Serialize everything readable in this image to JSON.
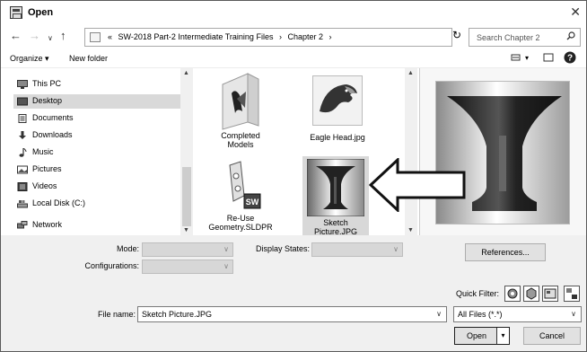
{
  "window": {
    "title": "Open"
  },
  "nav": {
    "breadcrumb": [
      "«",
      "SW-2018 Part-2 Intermediate Training Files",
      "Chapter 2"
    ],
    "search_placeholder": "Search Chapter 2"
  },
  "toolbar": {
    "organize": "Organize ▾",
    "new_folder": "New folder"
  },
  "sidebar": {
    "items": [
      {
        "label": "This PC",
        "icon": "computer-icon"
      },
      {
        "label": "Desktop",
        "icon": "desktop-icon"
      },
      {
        "label": "Documents",
        "icon": "documents-icon"
      },
      {
        "label": "Downloads",
        "icon": "downloads-icon"
      },
      {
        "label": "Music",
        "icon": "music-icon"
      },
      {
        "label": "Pictures",
        "icon": "pictures-icon"
      },
      {
        "label": "Videos",
        "icon": "videos-icon"
      },
      {
        "label": "Local Disk (C:)",
        "icon": "drive-icon"
      },
      {
        "label": "Network",
        "icon": "network-icon"
      }
    ]
  },
  "files": [
    {
      "name1": "Completed",
      "name2": "Models"
    },
    {
      "name1": "Eagle Head.jpg",
      "name2": ""
    },
    {
      "name1": "Re-Use",
      "name2": "Geometry.SLDPR"
    },
    {
      "name1": "Sketch",
      "name2": "Picture.JPG"
    }
  ],
  "options": {
    "mode_label": "Mode:",
    "configurations_label": "Configurations:",
    "display_states_label": "Display States:",
    "references_button": "References...",
    "quick_filter_label": "Quick Filter:"
  },
  "file_name_label": "File name:",
  "file_name_value": "Sketch Picture.JPG",
  "file_type_value": "All Files (*.*)",
  "open_button": "Open",
  "cancel_button": "Cancel"
}
